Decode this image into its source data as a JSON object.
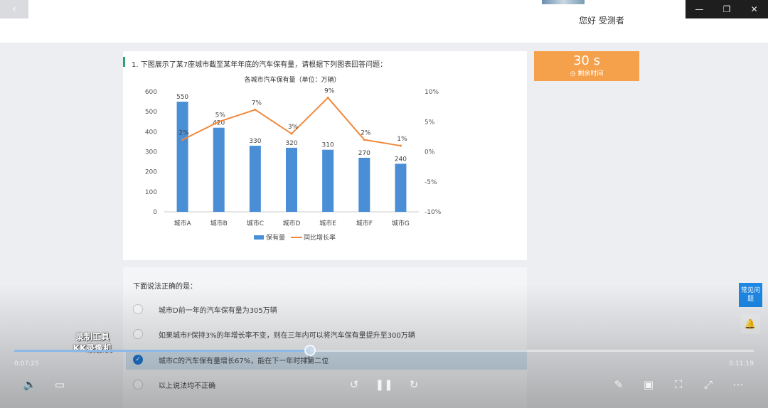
{
  "topbar": {
    "back_icon": "‹",
    "greeting": "您好 受测者",
    "win_min": "—",
    "win_restore": "❐",
    "win_close": "✕"
  },
  "question": {
    "text": "1.  下图展示了某7座城市截至某年年底的汽车保有量，请根据下列图表回答问题：",
    "chart_title": "各城市汽车保有量（单位：万辆）"
  },
  "chart_data": {
    "type": "bar",
    "title": "各城市汽车保有量（单位：万辆）",
    "categories": [
      "城市A",
      "城市B",
      "城市C",
      "城市D",
      "城市E",
      "城市F",
      "城市G"
    ],
    "series": [
      {
        "name": "保有量",
        "type": "bar",
        "axis": "left",
        "color": "#4a8fd6",
        "values": [
          550,
          420,
          330,
          320,
          310,
          270,
          240
        ],
        "labels": [
          "550",
          "420",
          "330",
          "320",
          "310",
          "270",
          "240"
        ]
      },
      {
        "name": "同比增长率",
        "type": "line",
        "axis": "right",
        "color": "#f0883c",
        "values": [
          2,
          5,
          7,
          3,
          9,
          2,
          1
        ],
        "labels": [
          "2%",
          "5%",
          "7%",
          "3%",
          "9%",
          "2%",
          "1%"
        ]
      }
    ],
    "y_left": {
      "min": 0,
      "max": 600,
      "ticks": [
        "0",
        "100",
        "200",
        "300",
        "400",
        "500",
        "600"
      ]
    },
    "y_right": {
      "min": -10,
      "max": 10,
      "ticks": [
        "-10%",
        "-5%",
        "0%",
        "5%",
        "10%"
      ]
    },
    "legend": [
      "保有量",
      "同比增长率"
    ],
    "legend_position": "bottom",
    "grid": false
  },
  "timer": {
    "value": "30 s",
    "label": "◷ 剩余时间",
    "color": "#f5a14b"
  },
  "options": {
    "prompt": "下面说法正确的是：",
    "items": [
      {
        "text": "城市D前一年的汽车保有量为305万辆",
        "mark": ""
      },
      {
        "text": "如果城市F保持3%的年增长率不变，则在三年内可以将汽车保有量提升至300万辆",
        "mark": ""
      },
      {
        "text": "城市C的汽车保有量增长67%，能在下一年时排第二位",
        "mark": "✓"
      },
      {
        "text": "以上说法均不正确",
        "mark": ""
      }
    ]
  },
  "side": {
    "faq": "常见问题",
    "bell_icon": "🔔"
  },
  "player": {
    "watermark_line1": "录制工具",
    "watermark_line2": "KK录像机",
    "time_current": "0:07:25",
    "time_total": "0:11:19",
    "progress": 0.4,
    "icons": {
      "volume": "🔈",
      "subtitle": "▭",
      "rewind": "↺",
      "pause": "❚❚",
      "forward": "↻",
      "pen": "✎",
      "window": "▣",
      "shot": "⛶",
      "fullscreen": "⤢",
      "more": "⋯"
    }
  }
}
